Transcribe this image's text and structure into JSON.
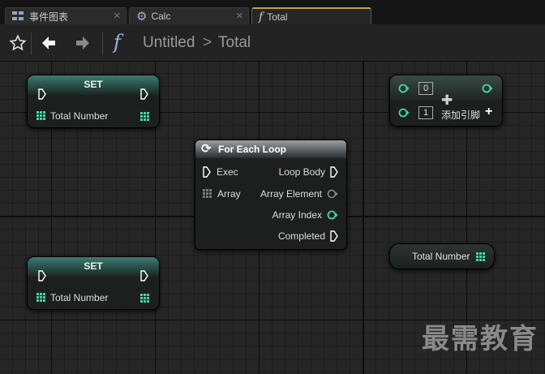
{
  "tabs": [
    {
      "label": "事件图表",
      "icon": "event-graph-icon",
      "active": false
    },
    {
      "label": "Calc",
      "icon": "gear-icon",
      "active": false
    },
    {
      "label": "Total",
      "icon": "function-icon",
      "active": true
    }
  ],
  "breadcrumb": {
    "root": "Untitled",
    "separator": ">",
    "current": "Total"
  },
  "colors": {
    "exec": "#ffffff",
    "integer": "#3fd8a2",
    "header_set": "#3f7a6e",
    "array_element": "#8a8a8a",
    "wildcard": "#7a7a7a"
  },
  "nodes": {
    "set_top": {
      "title": "SET",
      "var_label": "Total Number"
    },
    "set_bottom": {
      "title": "SET",
      "var_label": "Total Number"
    },
    "for_each": {
      "title": "For Each Loop",
      "inputs": {
        "exec": "Exec",
        "array": "Array"
      },
      "outputs": {
        "loop_body": "Loop Body",
        "array_element": "Array Element",
        "array_index": "Array Index",
        "completed": "Completed"
      }
    },
    "make_array": {
      "index0": "0",
      "index1": "1",
      "add_pin_label": "添加引脚",
      "add_symbol": "+"
    },
    "get_total": {
      "var_label": "Total Number"
    }
  },
  "watermark": "最需教育"
}
